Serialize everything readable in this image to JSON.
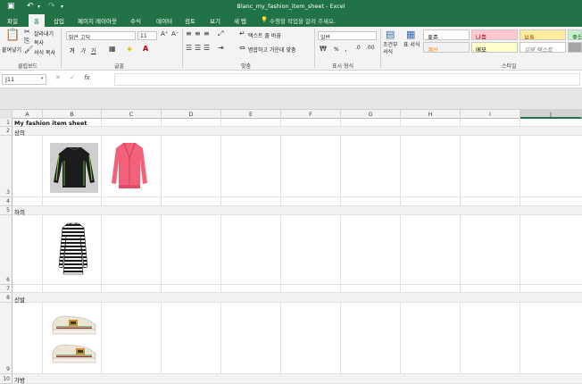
{
  "app": {
    "title": "Blanc_my_fashion_item_sheet - Excel",
    "accent": "#217346"
  },
  "menu": {
    "tabs": [
      "파일",
      "홈",
      "삽입",
      "페이지 레이아웃",
      "수식",
      "데이터",
      "검토",
      "보기",
      "새 탭"
    ],
    "active": "홈",
    "tell_me": "수행할 작업을 알려 주세요."
  },
  "ribbon": {
    "clipboard": {
      "label": "클립보드",
      "paste": "붙여넣기",
      "cut": "잘라내기",
      "copy": "복사",
      "format_painter": "서식 복사"
    },
    "font": {
      "label": "글꼴",
      "name": "맑은 고딕",
      "size": "11",
      "bold": "가",
      "italic": "가",
      "underline": "가"
    },
    "alignment": {
      "label": "맞춤",
      "wrap_text": "텍스트 줄 바꿈",
      "merge_center": "병합하고 가운데 맞춤"
    },
    "number": {
      "label": "표시 형식",
      "format": "일반",
      "percent": "%"
    },
    "styles": {
      "label": "스타일",
      "conditional": "조건부 서식",
      "table": "표 서식",
      "items": [
        {
          "text": "표준",
          "bg": "#ffffff",
          "color": "#000000"
        },
        {
          "text": "나쁨",
          "bg": "#ffc7ce",
          "color": "#9c0006"
        },
        {
          "text": "보통",
          "bg": "#ffeb9c",
          "color": "#9c5700"
        },
        {
          "text": "좋음",
          "bg": "#c6efce",
          "color": "#006100"
        },
        {
          "text": "계산",
          "bg": "#f2f2f2",
          "color": "#fa7d00"
        },
        {
          "text": "메모",
          "bg": "#ffffcc",
          "color": "#000000"
        },
        {
          "text": "설명 텍스트",
          "bg": "#ffffff",
          "color": "#7f7f7f"
        }
      ]
    }
  },
  "formula_bar": {
    "name_box": "J11",
    "cancel_glyph": "✕",
    "enter_glyph": "✓",
    "fx": "fx",
    "content": ""
  },
  "sheet": {
    "columns": [
      "A",
      "B",
      "C",
      "D",
      "E",
      "F",
      "G",
      "H",
      "I",
      "J"
    ],
    "selected_column": "J",
    "rows": [
      "1",
      "2",
      "3",
      "4",
      "5",
      "6",
      "7",
      "8",
      "9",
      "10"
    ],
    "cells": {
      "A1": "My fashion item sheet",
      "A2": "상의",
      "A5": "하의",
      "A8": "신발",
      "A10": "가방"
    },
    "images": [
      {
        "cell": "B3",
        "name": "black-compression-top"
      },
      {
        "cell": "C3",
        "name": "pink-cardigan"
      },
      {
        "cell": "B6",
        "name": "striped-dress"
      },
      {
        "cell": "B9",
        "name": "sneakers"
      }
    ]
  }
}
